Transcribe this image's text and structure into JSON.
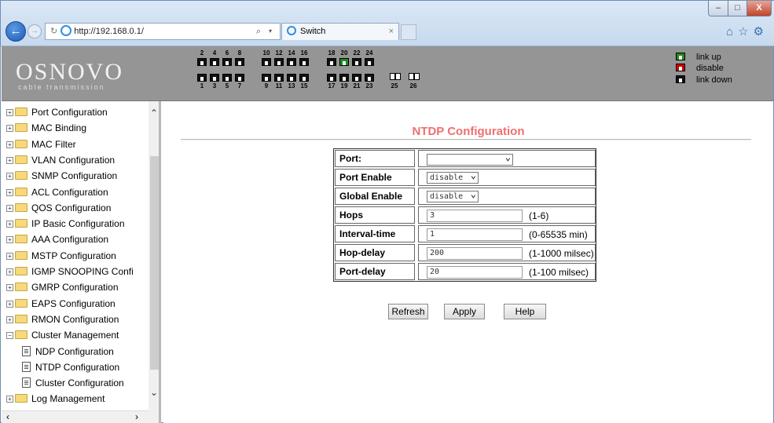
{
  "browser": {
    "address": "http://192.168.0.1/",
    "tab_title": "Switch",
    "tab_close": "×",
    "window_buttons": {
      "minimize": "–",
      "maximize": "□",
      "close": "X"
    },
    "toolbar_icons": [
      "home-icon",
      "star-icon",
      "gear-icon"
    ]
  },
  "banner": {
    "logo": "OSNOVO",
    "logo_sub": "cable transmission",
    "top_port_numbers": [
      "2",
      "4",
      "6",
      "8",
      "10",
      "12",
      "14",
      "16",
      "18",
      "20",
      "22",
      "24"
    ],
    "bottom_port_numbers": [
      "1",
      "3",
      "5",
      "7",
      "9",
      "11",
      "13",
      "15",
      "17",
      "19",
      "21",
      "23"
    ],
    "uplink_port_numbers": [
      "25",
      "26"
    ],
    "port_status": {
      "up": [
        "20"
      ],
      "disable": [],
      "down": "all-others"
    },
    "legend": [
      {
        "label": "link up",
        "color": "#1f8a1f"
      },
      {
        "label": "disable",
        "color": "#cc0000"
      },
      {
        "label": "link down",
        "color": "#111111"
      }
    ]
  },
  "sidebar": {
    "items": [
      {
        "label": "Port Configuration",
        "type": "folder"
      },
      {
        "label": "MAC Binding",
        "type": "folder"
      },
      {
        "label": "MAC Filter",
        "type": "folder"
      },
      {
        "label": "VLAN Configuration",
        "type": "folder"
      },
      {
        "label": "SNMP Configuration",
        "type": "folder"
      },
      {
        "label": "ACL Configuration",
        "type": "folder"
      },
      {
        "label": "QOS Configuration",
        "type": "folder"
      },
      {
        "label": "IP Basic Configuration",
        "type": "folder"
      },
      {
        "label": "AAA Configuration",
        "type": "folder"
      },
      {
        "label": "MSTP Configuration",
        "type": "folder"
      },
      {
        "label": "IGMP SNOOPING Confi",
        "type": "folder"
      },
      {
        "label": "GMRP Configuration",
        "type": "folder"
      },
      {
        "label": "EAPS Configuration",
        "type": "folder"
      },
      {
        "label": "RMON Configuration",
        "type": "folder"
      },
      {
        "label": "Cluster Management",
        "type": "folder-open"
      },
      {
        "label": "NDP Configuration",
        "type": "page"
      },
      {
        "label": "NTDP Configuration",
        "type": "page"
      },
      {
        "label": "Cluster Configuration",
        "type": "page"
      },
      {
        "label": "Log Management",
        "type": "folder"
      }
    ]
  },
  "main": {
    "title": "NTDP Configuration",
    "rows": [
      {
        "label": "Port:",
        "kind": "select",
        "value": ""
      },
      {
        "label": "Port Enable",
        "kind": "select",
        "value": "disable"
      },
      {
        "label": "Global Enable",
        "kind": "select",
        "value": "disable"
      },
      {
        "label": "Hops",
        "kind": "input",
        "value": "3",
        "range": "(1-6)"
      },
      {
        "label": "Interval-time",
        "kind": "input",
        "value": "1",
        "range": "(0-65535 min)"
      },
      {
        "label": "Hop-delay",
        "kind": "input",
        "value": "200",
        "range": "(1-1000 milsec)"
      },
      {
        "label": "Port-delay",
        "kind": "input",
        "value": "20",
        "range": "(1-100 milsec)"
      }
    ],
    "buttons": {
      "refresh": "Refresh",
      "apply": "Apply",
      "help": "Help"
    }
  }
}
